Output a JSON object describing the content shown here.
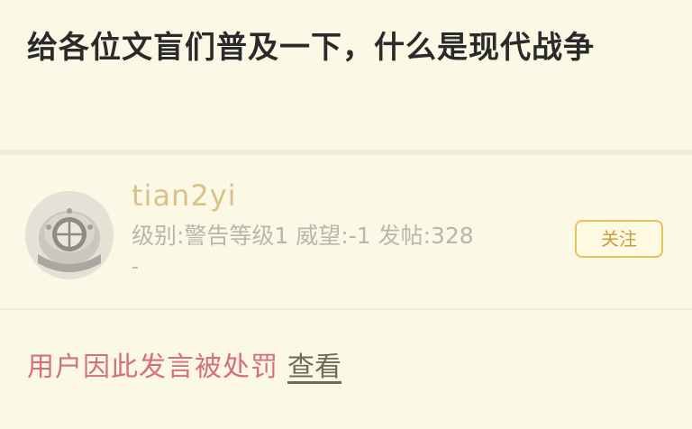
{
  "post": {
    "title": "给各位文盲们普及一下，什么是现代战争"
  },
  "user": {
    "name": "tian2yi",
    "meta_line": "级别:警告等级1 威望:-1 发帖:328",
    "meta_dash": "-",
    "follow_label": "关注",
    "avatar_icon": "diving-helmet-icon"
  },
  "notice": {
    "text": "用户因此发言被处罚",
    "link_label": "查看",
    "text_color": "#d4707a"
  },
  "colors": {
    "background": "#fbf8e6",
    "username": "#d9c28a",
    "follow_border": "#e6c25a"
  }
}
